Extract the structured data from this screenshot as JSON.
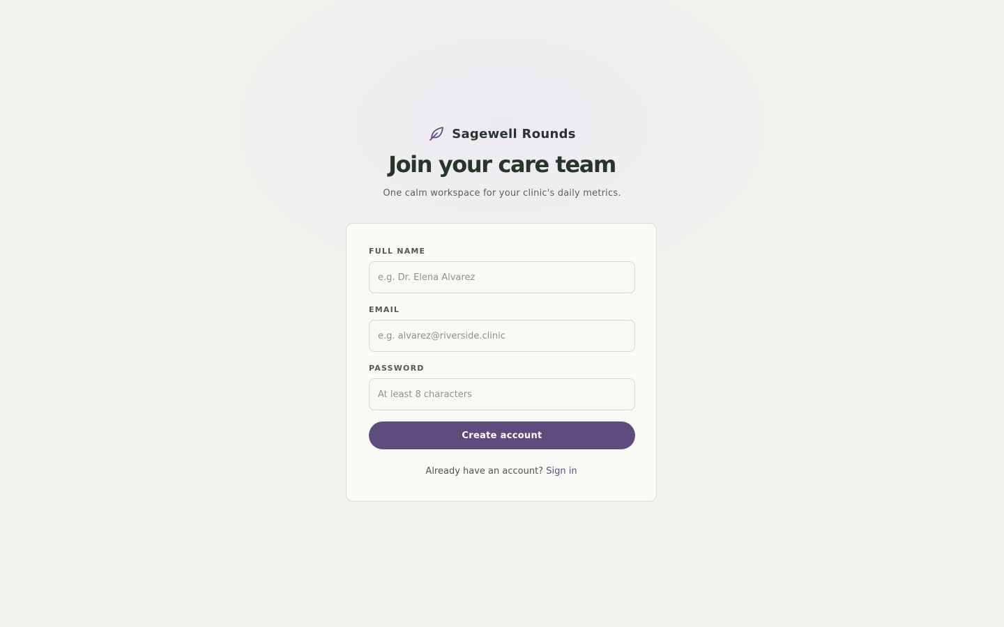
{
  "brand": {
    "name": "Sagewell Rounds",
    "icon": "leaf-icon",
    "accent_color": "#5e4c7f"
  },
  "header": {
    "title": "Join your care team",
    "subtitle": "One calm workspace for your clinic's daily metrics."
  },
  "form": {
    "full_name": {
      "label": "FULL NAME",
      "placeholder": "e.g. Dr. Elena Alvarez",
      "value": ""
    },
    "email": {
      "label": "EMAIL",
      "placeholder": "e.g. alvarez@riverside.clinic",
      "value": ""
    },
    "password": {
      "label": "PASSWORD",
      "placeholder": "At least 8 characters",
      "value": ""
    },
    "submit_label": "Create account"
  },
  "footer": {
    "prompt": "Already have an account?",
    "link_label": "Sign in"
  }
}
